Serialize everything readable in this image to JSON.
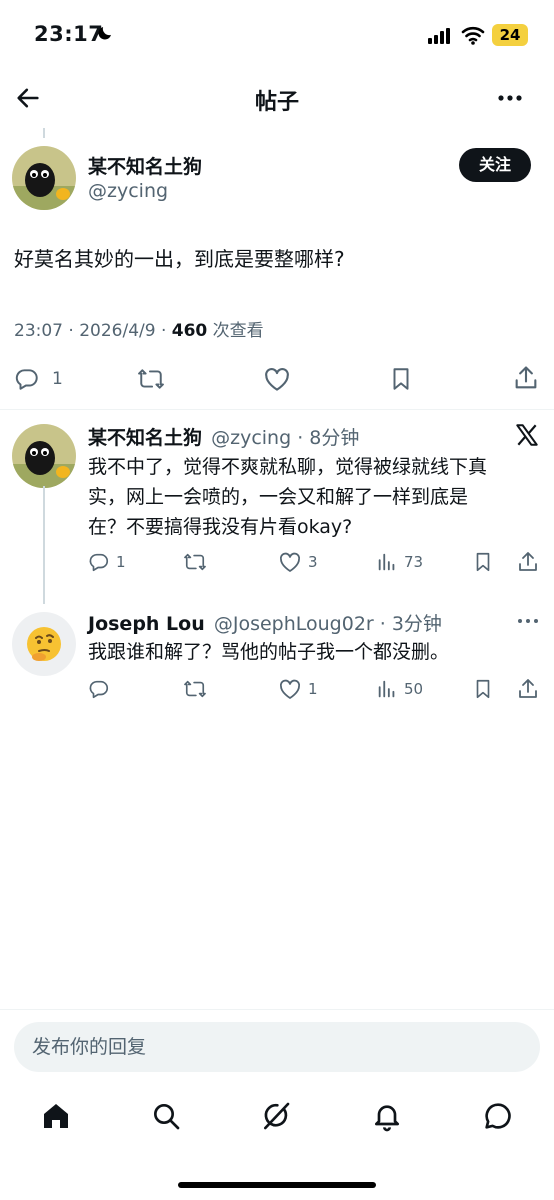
{
  "status": {
    "time": "23:17",
    "battery": "24"
  },
  "header": {
    "title": "帖子"
  },
  "post": {
    "author_name": "某不知名土狗",
    "author_handle": "@zycing",
    "follow_label": "关注",
    "text": "好莫名其妙的一出，到底是要整哪样?",
    "timestamp": "23:07 · 2026/4/9 · ",
    "views": "460",
    "views_label": " 次查看",
    "reply_count": "1"
  },
  "replies": [
    {
      "author_name": "某不知名土狗",
      "author_handle": "@zycing · 8分钟",
      "lines": [
        "我不中了，觉得不爽就私聊，觉得被绿就线下真",
        "实，网上一会喷的，一会又和解了一样到底是",
        "在？不要搞得我没有片看okay?"
      ],
      "reply_count": "1",
      "like_count": "3",
      "view_count": "73"
    },
    {
      "author_name": "Joseph Lou",
      "author_handle": "@JosephLoug02r · 3分钟",
      "lines": [
        "我跟谁和解了？骂他的帖子我一个都没删。"
      ],
      "like_count": "1",
      "view_count": "50"
    }
  ],
  "composer": {
    "placeholder": "发布你的回复"
  },
  "icons": [
    "back-arrow-icon",
    "more-icon",
    "reply-icon",
    "retweet-icon",
    "like-icon",
    "bookmark-icon",
    "share-icon",
    "analytics-icon",
    "x-logo-icon",
    "home-icon",
    "search-icon",
    "grok-icon",
    "notifications-icon",
    "messages-icon"
  ],
  "colors": {
    "text": "#0f1419",
    "secondary": "#536471",
    "battery": "#f4d03f",
    "composer_bg": "#eff3f4"
  }
}
